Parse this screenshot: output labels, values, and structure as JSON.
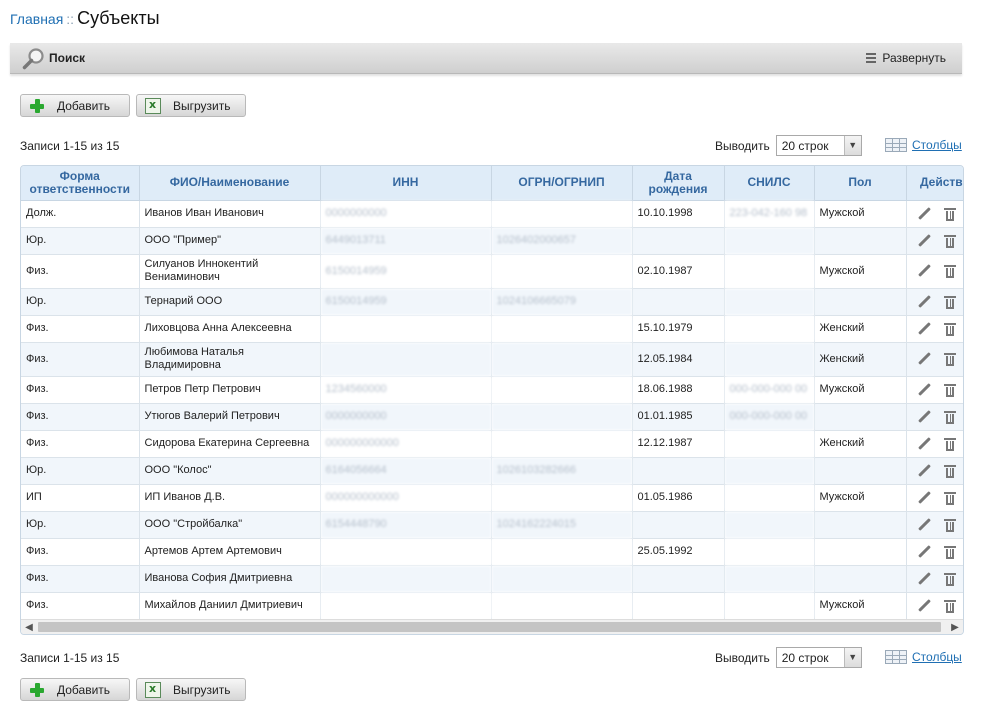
{
  "breadcrumb": {
    "home": "Главная",
    "separator": "::",
    "title": "Субъекты"
  },
  "search": {
    "label": "Поиск",
    "expand_label": "Развернуть"
  },
  "toolbar": {
    "add_label": "Добавить",
    "export_label": "Выгрузить"
  },
  "pagination": {
    "records_text": "Записи 1-15 из 15",
    "per_page_label": "Выводить",
    "per_page_value": "20 строк",
    "columns_link": "Столбцы"
  },
  "table": {
    "columns": [
      "Форма ответственности",
      "ФИО/Наименование",
      "ИНН",
      "ОГРН/ОГРНИП",
      "Дата рождения",
      "СНИЛС",
      "Пол",
      "Действия"
    ],
    "rows": [
      {
        "form": "Долж.",
        "name": "Иванов Иван Иванович",
        "inn": "0000000000",
        "ogrn": "",
        "birth": "10.10.1998",
        "snils": "223-042-160 98",
        "gender": "Мужской"
      },
      {
        "form": "Юр.",
        "name": "ООО \"Пример\"",
        "inn": "6449013711",
        "ogrn": "1026402000657",
        "birth": "",
        "snils": "",
        "gender": ""
      },
      {
        "form": "Физ.",
        "name": "Силуанов Иннокентий Вениаминович",
        "inn": "6150014959",
        "ogrn": "",
        "birth": "02.10.1987",
        "snils": "",
        "gender": "Мужской"
      },
      {
        "form": "Юр.",
        "name": "Тернарий ООО",
        "inn": "6150014959",
        "ogrn": "1024106665079",
        "birth": "",
        "snils": "",
        "gender": ""
      },
      {
        "form": "Физ.",
        "name": "Лиховцова Анна Алексеевна",
        "inn": "",
        "ogrn": "",
        "birth": "15.10.1979",
        "snils": "",
        "gender": "Женский"
      },
      {
        "form": "Физ.",
        "name": "Любимова Наталья Владимировна",
        "inn": "",
        "ogrn": "",
        "birth": "12.05.1984",
        "snils": "",
        "gender": "Женский"
      },
      {
        "form": "Физ.",
        "name": "Петров Петр Петрович",
        "inn": "1234560000",
        "ogrn": "",
        "birth": "18.06.1988",
        "snils": "000-000-000 00",
        "gender": "Мужской"
      },
      {
        "form": "Физ.",
        "name": "Утюгов Валерий Петрович",
        "inn": "0000000000",
        "ogrn": "",
        "birth": "01.01.1985",
        "snils": "000-000-000 00",
        "gender": ""
      },
      {
        "form": "Физ.",
        "name": "Сидорова Екатерина Сергеевна",
        "inn": "000000000000",
        "ogrn": "",
        "birth": "12.12.1987",
        "snils": "",
        "gender": "Женский"
      },
      {
        "form": "Юр.",
        "name": "ООО \"Колос\"",
        "inn": "6164056664",
        "ogrn": "1026103282666",
        "birth": "",
        "snils": "",
        "gender": ""
      },
      {
        "form": "ИП",
        "name": "ИП Иванов Д.В.",
        "inn": "000000000000",
        "ogrn": "",
        "birth": "01.05.1986",
        "snils": "",
        "gender": "Мужской"
      },
      {
        "form": "Юр.",
        "name": "ООО \"Стройбалка\"",
        "inn": "6154448790",
        "ogrn": "1024162224015",
        "birth": "",
        "snils": "",
        "gender": ""
      },
      {
        "form": "Физ.",
        "name": "Артемов Артем Артемович",
        "inn": "",
        "ogrn": "",
        "birth": "25.05.1992",
        "snils": "",
        "gender": ""
      },
      {
        "form": "Физ.",
        "name": "Иванова София Дмитриевна",
        "inn": "",
        "ogrn": "",
        "birth": "",
        "snils": "",
        "gender": ""
      },
      {
        "form": "Физ.",
        "name": "Михайлов Даниил Дмитриевич",
        "inn": "",
        "ogrn": "",
        "birth": "",
        "snils": "",
        "gender": "Мужской"
      }
    ]
  }
}
